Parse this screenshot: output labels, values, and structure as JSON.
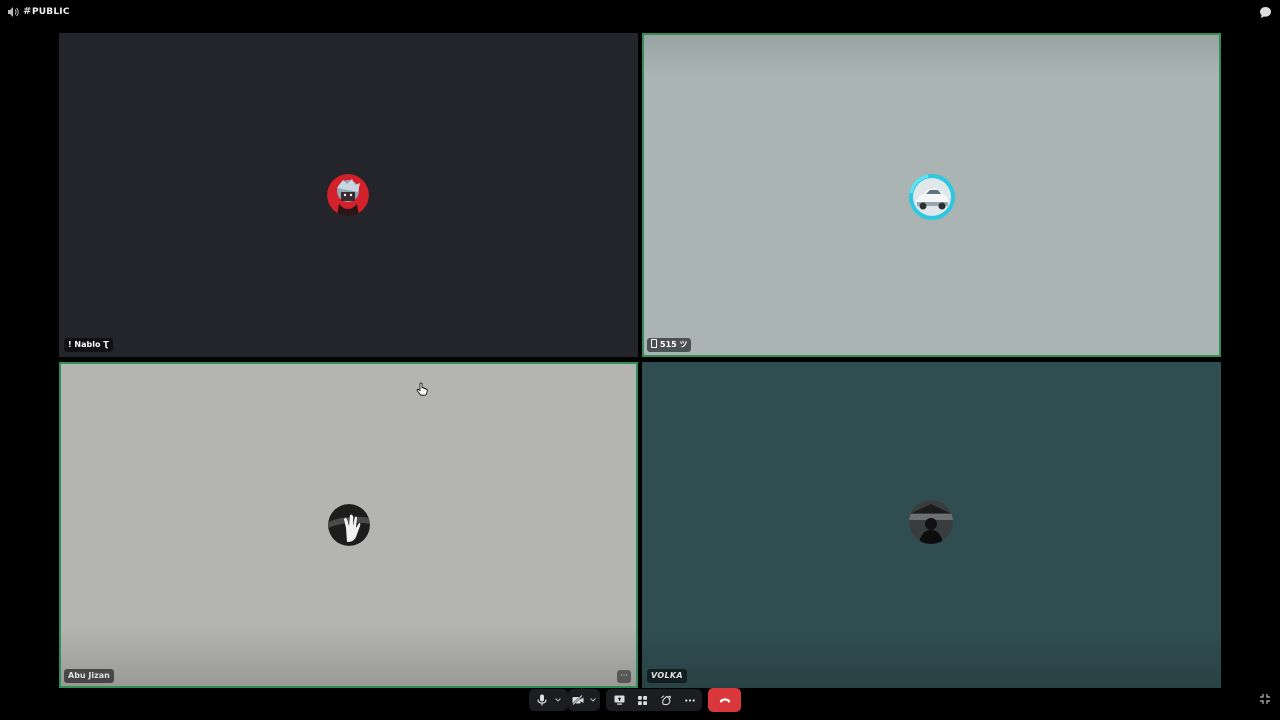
{
  "topbar": {
    "channel_hash": "#",
    "channel_name": "PUBLIC",
    "speaker_icon": "speaker-icon",
    "chat_icon": "chat-bubble-icon"
  },
  "participants": [
    {
      "name": "! Nablo Ʈ",
      "avatar": "anime-avatar-red",
      "bg": "#24252a",
      "speaking": false
    },
    {
      "name": "515 ツ",
      "device": "mobile",
      "avatar": "car-avatar-cyan-ring",
      "bg": "#a9b4b3",
      "speaking": true
    },
    {
      "name": "Abu Jizan",
      "avatar": "hand-avatar-monochrome",
      "bg": "#b4b4b3",
      "speaking": true,
      "more_label": "···"
    },
    {
      "name": "VOLKA",
      "avatar": "silhouette-avatar-dark",
      "bg": "#304d52",
      "speaking": false
    }
  ],
  "controls": {
    "mic": "microphone-icon",
    "mic_options": "chevron-down-icon",
    "camera": "camera-off-icon",
    "camera_options": "chevron-down-icon",
    "share": "screen-share-icon",
    "activities": "activities-icon",
    "soundboard": "soundboard-icon",
    "more": "more-icon",
    "end_call": "end-call-icon",
    "fullscreen": "fullscreen-exit-icon"
  },
  "colors": {
    "speaking_border": "#2f8f55",
    "end_call": "#da373c",
    "control_bg": "#1c1d21"
  }
}
